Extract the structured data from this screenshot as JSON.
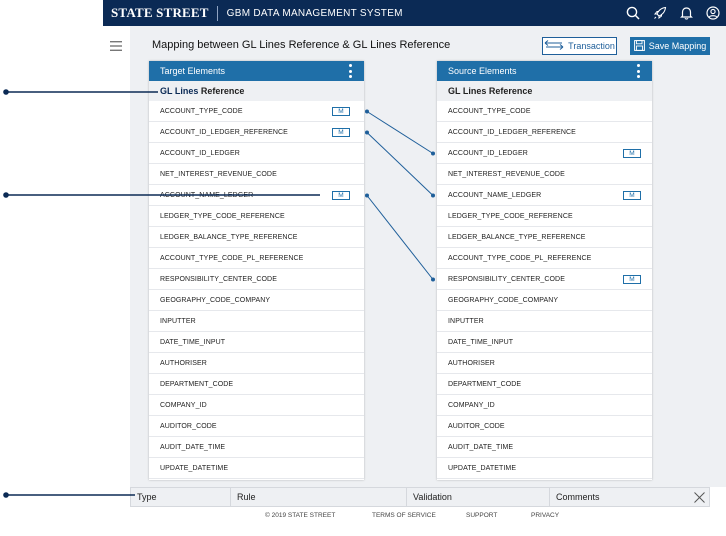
{
  "header": {
    "brand": "STATE STREET",
    "app_title": "GBM DATA MANAGEMENT SYSTEM",
    "icons": [
      "search-icon",
      "rocket-icon",
      "bell-icon",
      "user-icon"
    ],
    "background_color": "#0b2a55"
  },
  "page": {
    "title": "Mapping between GL Lines Reference & GL Lines Reference",
    "transaction_button": "Transaction",
    "save_button": "Save Mapping",
    "accent_color": "#1f6fa8"
  },
  "target": {
    "header": "Target Elements",
    "subtitle_highlight": "GL Lines",
    "subtitle_rest": " Reference",
    "rows": [
      {
        "label": "ACCOUNT_TYPE_CODE",
        "badge": "M"
      },
      {
        "label": "ACCOUNT_ID_LEDGER_REFERENCE",
        "badge": "M"
      },
      {
        "label": "ACCOUNT_ID_LEDGER",
        "badge": ""
      },
      {
        "label": "NET_INTEREST_REVENUE_CODE",
        "badge": ""
      },
      {
        "label": "ACCOUNT_NAME_LEDGER",
        "badge": "M"
      },
      {
        "label": "LEDGER_TYPE_CODE_REFERENCE",
        "badge": ""
      },
      {
        "label": "LEDGER_BALANCE_TYPE_REFERENCE",
        "badge": ""
      },
      {
        "label": "ACCOUNT_TYPE_CODE_PL_REFERENCE",
        "badge": ""
      },
      {
        "label": "RESPONSIBILITY_CENTER_CODE",
        "badge": ""
      },
      {
        "label": "GEOGRAPHY_CODE_COMPANY",
        "badge": ""
      },
      {
        "label": "INPUTTER",
        "badge": ""
      },
      {
        "label": "DATE_TIME_INPUT",
        "badge": ""
      },
      {
        "label": "AUTHORISER",
        "badge": ""
      },
      {
        "label": "DEPARTMENT_CODE",
        "badge": ""
      },
      {
        "label": "COMPANY_ID",
        "badge": ""
      },
      {
        "label": "AUDITOR_CODE",
        "badge": ""
      },
      {
        "label": "AUDIT_DATE_TIME",
        "badge": ""
      },
      {
        "label": "UPDATE_DATETIME",
        "badge": ""
      }
    ]
  },
  "source": {
    "header": "Source Elements",
    "subtitle": "GL Lines Reference",
    "rows": [
      {
        "label": "ACCOUNT_TYPE_CODE",
        "badge": ""
      },
      {
        "label": "ACCOUNT_ID_LEDGER_REFERENCE",
        "badge": ""
      },
      {
        "label": "ACCOUNT_ID_LEDGER",
        "badge": "M"
      },
      {
        "label": "NET_INTEREST_REVENUE_CODE",
        "badge": ""
      },
      {
        "label": "ACCOUNT_NAME_LEDGER",
        "badge": "M"
      },
      {
        "label": "LEDGER_TYPE_CODE_REFERENCE",
        "badge": ""
      },
      {
        "label": "LEDGER_BALANCE_TYPE_REFERENCE",
        "badge": ""
      },
      {
        "label": "ACCOUNT_TYPE_CODE_PL_REFERENCE",
        "badge": ""
      },
      {
        "label": "RESPONSIBILITY_CENTER_CODE",
        "badge": "M"
      },
      {
        "label": "GEOGRAPHY_CODE_COMPANY",
        "badge": ""
      },
      {
        "label": "INPUTTER",
        "badge": ""
      },
      {
        "label": "DATE_TIME_INPUT",
        "badge": ""
      },
      {
        "label": "AUTHORISER",
        "badge": ""
      },
      {
        "label": "DEPARTMENT_CODE",
        "badge": ""
      },
      {
        "label": "COMPANY_ID",
        "badge": ""
      },
      {
        "label": "AUDITOR_CODE",
        "badge": ""
      },
      {
        "label": "AUDIT_DATE_TIME",
        "badge": ""
      },
      {
        "label": "UPDATE_DATETIME",
        "badge": ""
      }
    ]
  },
  "mappings": [
    {
      "target": "ACCOUNT_TYPE_CODE",
      "source": "ACCOUNT_ID_LEDGER"
    },
    {
      "target": "ACCOUNT_ID_LEDGER_REFERENCE",
      "source": "ACCOUNT_NAME_LEDGER"
    },
    {
      "target": "ACCOUNT_NAME_LEDGER",
      "source": "RESPONSIBILITY_CENTER_CODE"
    }
  ],
  "bottom_table": {
    "columns": [
      "Type",
      "Rule",
      "Validation",
      "Comments"
    ]
  },
  "footer": {
    "copyright": "©  2019 STATE STREET",
    "links": [
      "TERMS OF SERVICE",
      "SUPPORT",
      "PRIVACY"
    ]
  }
}
